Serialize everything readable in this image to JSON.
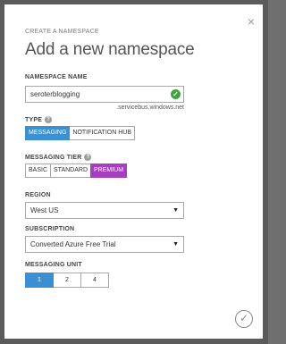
{
  "dialog": {
    "eyebrow": "CREATE A NAMESPACE",
    "title": "Add a new namespace",
    "close_glyph": "×"
  },
  "namespace": {
    "label": "NAMESPACE NAME",
    "value": "seroterblogging",
    "suffix": ".servicebus.windows.net",
    "valid_icon": "check-circle-icon"
  },
  "type": {
    "label": "TYPE",
    "options": [
      "MESSAGING",
      "NOTIFICATION HUB"
    ],
    "selected": "MESSAGING"
  },
  "tier": {
    "label": "MESSAGING TIER",
    "options": [
      "BASIC",
      "STANDARD",
      "PREMIUM"
    ],
    "selected": "PREMIUM"
  },
  "region": {
    "label": "REGION",
    "value": "West US"
  },
  "subscription": {
    "label": "SUBSCRIPTION",
    "value": "Converted Azure Free Trial"
  },
  "unit": {
    "label": "MESSAGING UNIT",
    "options": [
      "1",
      "2",
      "4"
    ],
    "selected": "1"
  },
  "help_glyph": "?",
  "colors": {
    "accent_blue": "#3b8fd3",
    "accent_purple": "#a53fbf",
    "valid_green": "#3ea43e"
  }
}
